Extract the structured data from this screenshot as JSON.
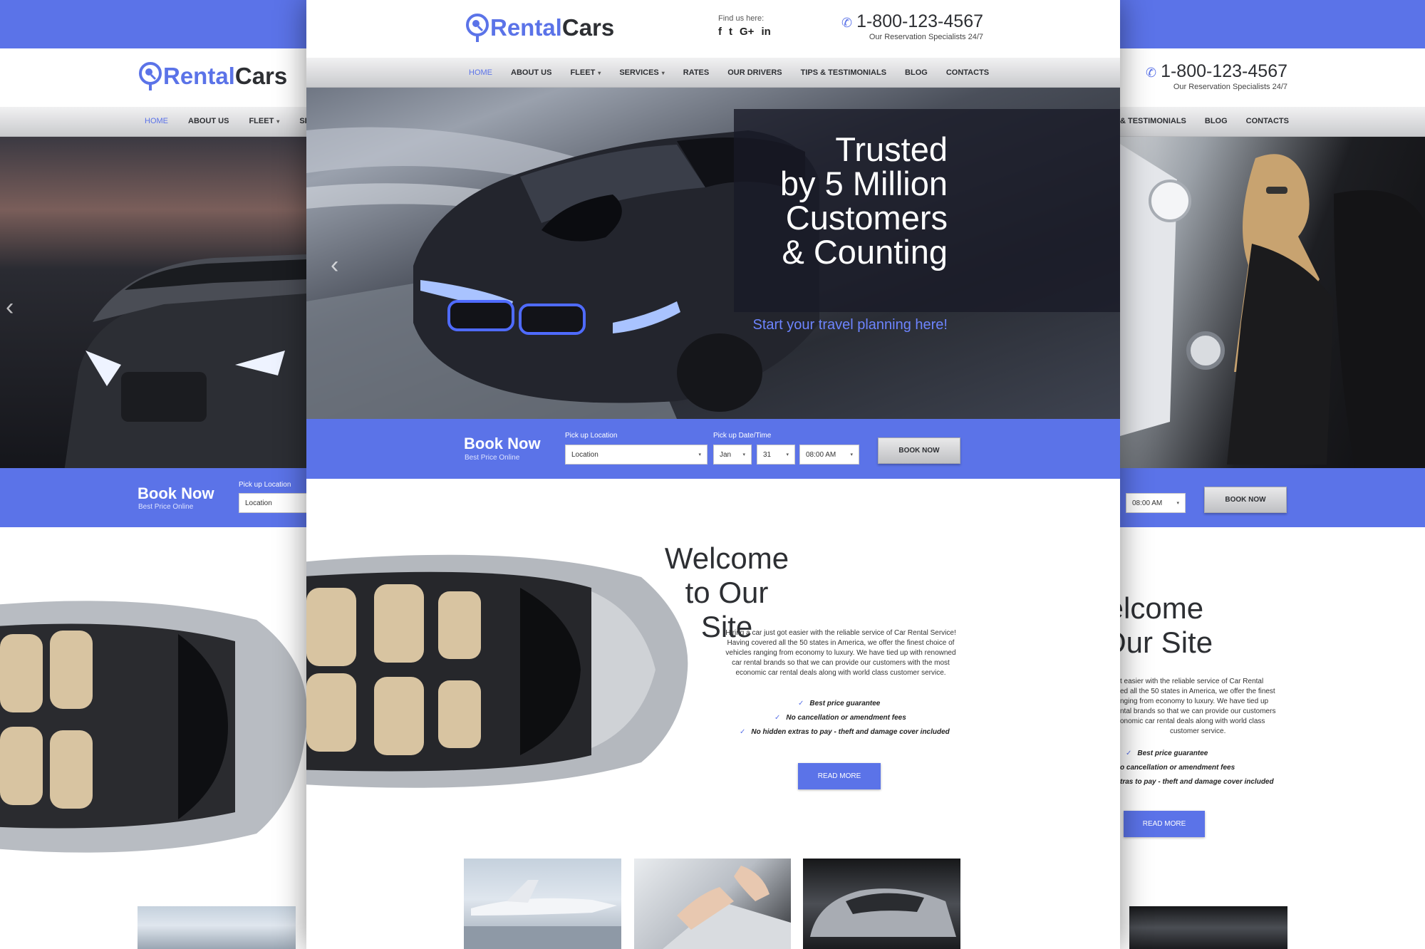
{
  "brand": {
    "name_part1": "Rental",
    "name_part2": "Cars",
    "accent_color": "#5b73e8",
    "dark_color": "#2d2f33"
  },
  "header": {
    "find_us": "Find us here:",
    "social": [
      {
        "icon": "facebook-icon",
        "glyph": "f"
      },
      {
        "icon": "twitter-icon",
        "glyph": "t"
      },
      {
        "icon": "google-plus-icon",
        "glyph": "G+"
      },
      {
        "icon": "linkedin-icon",
        "glyph": "in"
      }
    ],
    "phone": "1-800-123-4567",
    "phone_sub": "Our Reservation Specialists 24/7"
  },
  "nav": [
    {
      "label": "HOME",
      "active": true,
      "dropdown": false
    },
    {
      "label": "ABOUT US",
      "active": false,
      "dropdown": false
    },
    {
      "label": "FLEET",
      "active": false,
      "dropdown": true
    },
    {
      "label": "SERVICES",
      "active": false,
      "dropdown": true
    },
    {
      "label": "RATES",
      "active": false,
      "dropdown": false
    },
    {
      "label": "OUR DRIVERS",
      "active": false,
      "dropdown": false
    },
    {
      "label": "TIPS & TESTIMONIALS",
      "active": false,
      "dropdown": false
    },
    {
      "label": "BLOG",
      "active": false,
      "dropdown": false
    },
    {
      "label": "CONTACTS",
      "active": false,
      "dropdown": false
    }
  ],
  "left_nav_partial": {
    "home": "HOME",
    "about": "ABOUT US",
    "fleet": "FLEET",
    "services": "SERVI"
  },
  "right_nav_partial": {
    "tips": "& TESTIMONIALS",
    "blog": "BLOG",
    "contacts": "CONTACTS"
  },
  "hero": {
    "line1": "Trusted",
    "line2": "by 5 Million",
    "line3": "Customers",
    "line4": "& Counting",
    "tagline": "Start your travel planning here!"
  },
  "booking": {
    "title": "Book Now",
    "subtitle": "Best Price Online",
    "pickup_location_label": "Pick up Location",
    "pickup_location_value": "Location",
    "pickup_date_label": "Pick up Date/Time",
    "month": "Jan",
    "day": "31",
    "time": "08:00 AM",
    "button": "BOOK NOW"
  },
  "welcome": {
    "title_line1": "Welcome",
    "title_line2": "to Our Site",
    "body": "Hiring a car just got easier with the reliable service of Car Rental Service! Having covered all the 50 states in America, we offer the finest choice of vehicles ranging from economy to luxury. We have tied up with renowned car rental brands so that we can provide our customers with the most economic car rental deals along with world class customer service.",
    "features": [
      "Best price guarantee",
      "No cancellation or amendment fees",
      "No hidden extras to pay - theft and damage cover included"
    ],
    "button": "READ MORE"
  },
  "right_partial": {
    "title_line1": "/elcome",
    "title_line2": "Our Site",
    "body_lines": [
      "t easier with the reliable service of Car Rental",
      "ed all the 50 states in America, we offer the finest",
      "nging from economy to luxury. We have tied up",
      "ntal brands so that we can provide our customers",
      "onomic car rental deals along with world class",
      "customer service."
    ],
    "features": [
      "Best price guarantee",
      "o cancellation or amendment fees",
      "tras to pay - theft and damage cover included"
    ]
  }
}
